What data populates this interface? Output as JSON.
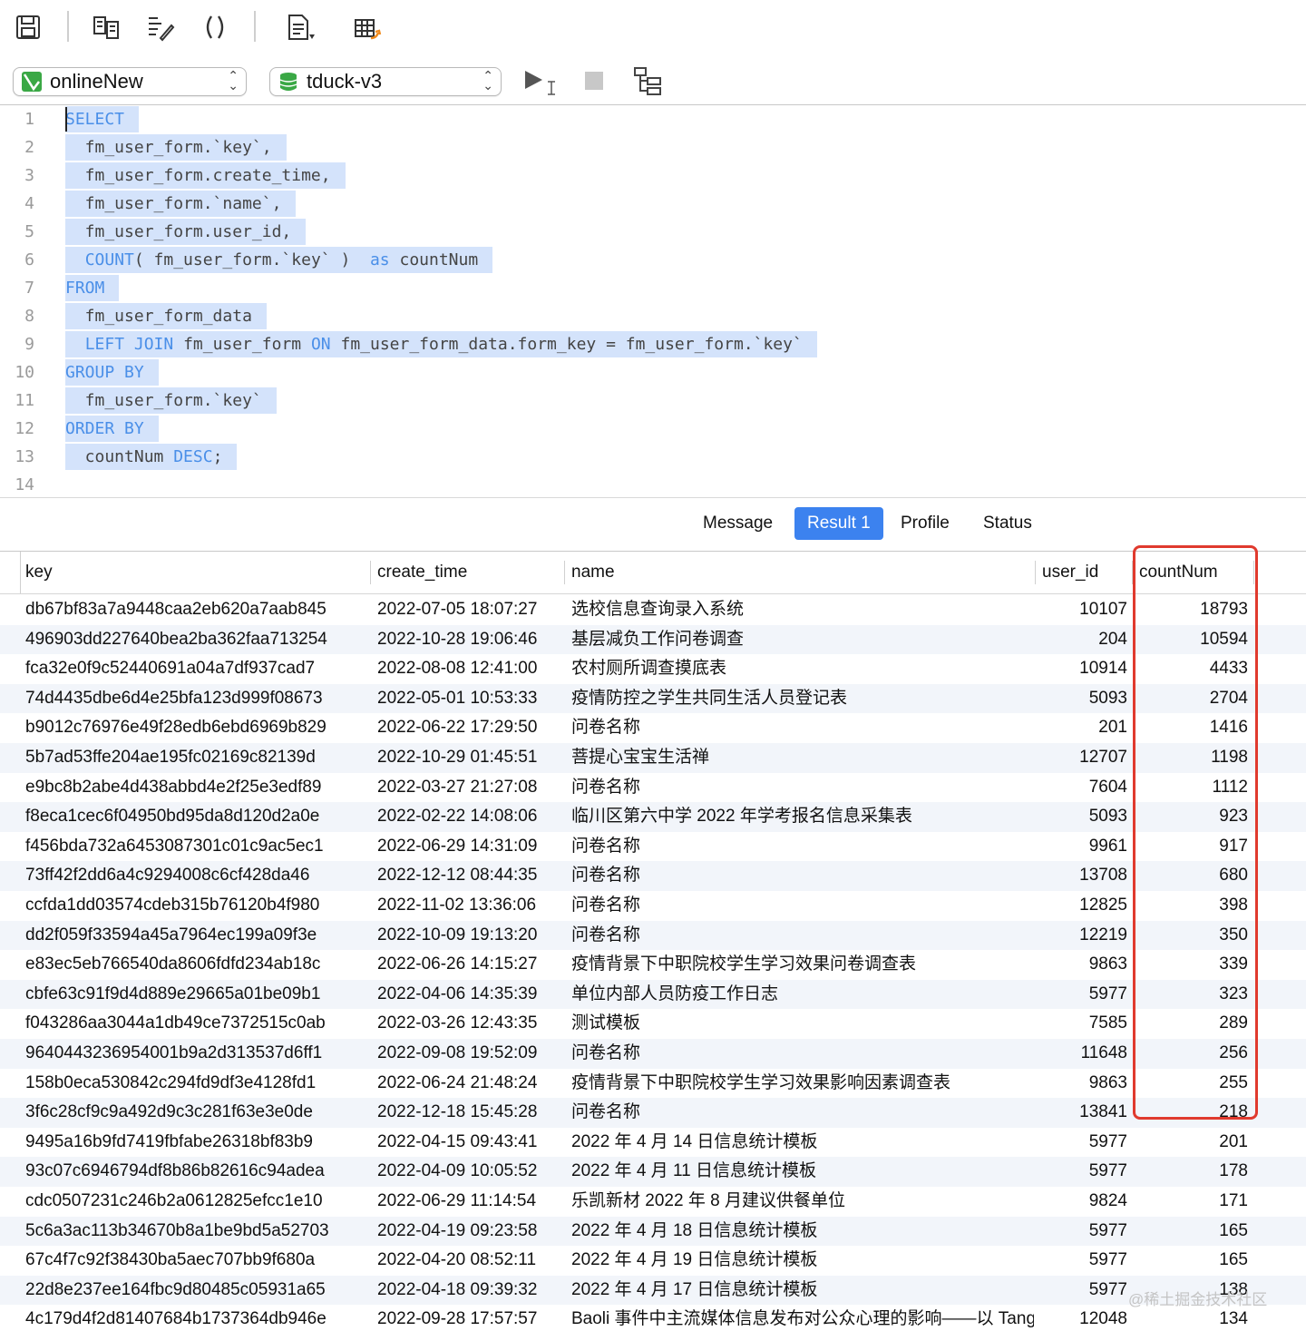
{
  "toolbar": {
    "icons": [
      "save-icon",
      "explain-icon",
      "format-sql-icon",
      "parentheses-icon",
      "snippet-icon",
      "export-table-icon"
    ]
  },
  "connection": {
    "server": "onlineNew",
    "database": "tduck-v3"
  },
  "editor": {
    "lines": [
      {
        "n": "1",
        "text": "SELECT"
      },
      {
        "n": "2",
        "text": "  fm_user_form.`key`,"
      },
      {
        "n": "3",
        "text": "  fm_user_form.create_time,"
      },
      {
        "n": "4",
        "text": "  fm_user_form.`name`,"
      },
      {
        "n": "5",
        "text": "  fm_user_form.user_id,"
      },
      {
        "n": "6",
        "text": "  COUNT( fm_user_form.`key` )  as countNum"
      },
      {
        "n": "7",
        "text": "FROM"
      },
      {
        "n": "8",
        "text": "  fm_user_form_data"
      },
      {
        "n": "9",
        "text": "  LEFT JOIN fm_user_form ON fm_user_form_data.form_key = fm_user_form.`key`"
      },
      {
        "n": "10",
        "text": "GROUP BY"
      },
      {
        "n": "11",
        "text": "  fm_user_form.`key`"
      },
      {
        "n": "12",
        "text": "ORDER BY"
      },
      {
        "n": "13",
        "text": "  countNum DESC;"
      },
      {
        "n": "14",
        "text": ""
      }
    ]
  },
  "tabs": [
    "Message",
    "Result 1",
    "Profile",
    "Status"
  ],
  "active_tab": "Result 1",
  "grid": {
    "columns": [
      "key",
      "create_time",
      "name",
      "user_id",
      "countNum"
    ],
    "rows": [
      [
        "db67bf83a7a9448caa2eb620a7aab845",
        "2022-07-05 18:07:27",
        "选校信息查询录入系统",
        "10107",
        "18793"
      ],
      [
        "496903dd227640bea2ba362faa713254",
        "2022-10-28 19:06:46",
        "基层减负工作问卷调查",
        "204",
        "10594"
      ],
      [
        "fca32e0f9c52440691a04a7df937cad7",
        "2022-08-08 12:41:00",
        "农村厕所调查摸底表",
        "10914",
        "4433"
      ],
      [
        "74d4435dbe6d4e25bfa123d999f08673",
        "2022-05-01 10:53:33",
        "疫情防控之学生共同生活人员登记表",
        "5093",
        "2704"
      ],
      [
        "b9012c76976e49f28edb6ebd6969b829",
        "2022-06-22 17:29:50",
        "问卷名称",
        "201",
        "1416"
      ],
      [
        "5b7ad53ffe204ae195fc02169c82139d",
        "2022-10-29 01:45:51",
        "菩提心宝宝生活禅",
        "12707",
        "1198"
      ],
      [
        "e9bc8b2abe4d438abbd4e2f25e3edf89",
        "2022-03-27 21:27:08",
        "问卷名称",
        "7604",
        "1112"
      ],
      [
        "f8eca1cec6f04950bd95da8d120d2a0e",
        "2022-02-22 14:08:06",
        "临川区第六中学 2022 年学考报名信息采集表",
        "5093",
        "923"
      ],
      [
        "f456bda732a6453087301c01c9ac5ec1",
        "2022-06-29 14:31:09",
        "问卷名称",
        "9961",
        "917"
      ],
      [
        "73ff42f2dd6a4c9294008c6cf428da46",
        "2022-12-12 08:44:35",
        "问卷名称",
        "13708",
        "680"
      ],
      [
        "ccfda1dd03574cdeb315b76120b4f980",
        "2022-11-02 13:36:06",
        "问卷名称",
        "12825",
        "398"
      ],
      [
        "dd2f059f33594a45a7964ec199a09f3e",
        "2022-10-09 19:13:20",
        "问卷名称",
        "12219",
        "350"
      ],
      [
        "e83ec5eb766540da8606fdfd234ab18c",
        "2022-06-26 14:15:27",
        "疫情背景下中职院校学生学习效果问卷调查表",
        "9863",
        "339"
      ],
      [
        "cbfe63c91f9d4d889e29665a01be09b1",
        "2022-04-06 14:35:39",
        "单位内部人员防疫工作日志",
        "5977",
        "323"
      ],
      [
        "f043286aa3044a1db49ce7372515c0ab",
        "2022-03-26 12:43:35",
        "测试模板",
        "7585",
        "289"
      ],
      [
        "9640443236954001b9a2d313537d6ff1",
        "2022-09-08 19:52:09",
        "问卷名称",
        "11648",
        "256"
      ],
      [
        "158b0eca530842c294fd9df3e4128fd1",
        "2022-06-24 21:48:24",
        "疫情背景下中职院校学生学习效果影响因素调查表",
        "9863",
        "255"
      ],
      [
        "3f6c28cf9c9a492d9c3c281f63e3e0de",
        "2022-12-18 15:45:28",
        "问卷名称",
        "13841",
        "218"
      ],
      [
        "9495a16b9fd7419fbfabe26318bf83b9",
        "2022-04-15 09:43:41",
        "2022 年 4 月 14 日信息统计模板",
        "5977",
        "201"
      ],
      [
        "93c07c6946794df8b86b82616c94adea",
        "2022-04-09 10:05:52",
        "2022 年 4 月 11 日信息统计模板",
        "5977",
        "178"
      ],
      [
        "cdc0507231c246b2a0612825efcc1e10",
        "2022-06-29 11:14:54",
        "乐凯新材 2022 年 8 月建议供餐单位",
        "9824",
        "171"
      ],
      [
        "5c6a3ac113b34670b8a1be9bd5a52703",
        "2022-04-19 09:23:58",
        "2022 年 4 月 18 日信息统计模板",
        "5977",
        "165"
      ],
      [
        "67c4f7c92f38430ba5aec707bb9f680a",
        "2022-04-20 08:52:11",
        "2022 年 4 月 19 日信息统计模板",
        "5977",
        "165"
      ],
      [
        "22d8e237ee164fbc9d80485c05931a65",
        "2022-04-18 09:39:32",
        "2022 年 4 月 17 日信息统计模板",
        "5977",
        "138"
      ],
      [
        "4c179d4f2d81407684b1737364db946e",
        "2022-09-28 17:57:57",
        "Baoli 事件中主流媒体信息发布对公众心理的影响——以 Tang",
        "12048",
        "134"
      ]
    ]
  },
  "watermark": "@稀土掘金技术社区",
  "colors": {
    "selection": "#d4e3fb",
    "keyword": "#4a8fe8",
    "active_tab": "#3c82ef",
    "highlight_box": "#e03a2e",
    "alt_row": "#f2f5fa"
  }
}
